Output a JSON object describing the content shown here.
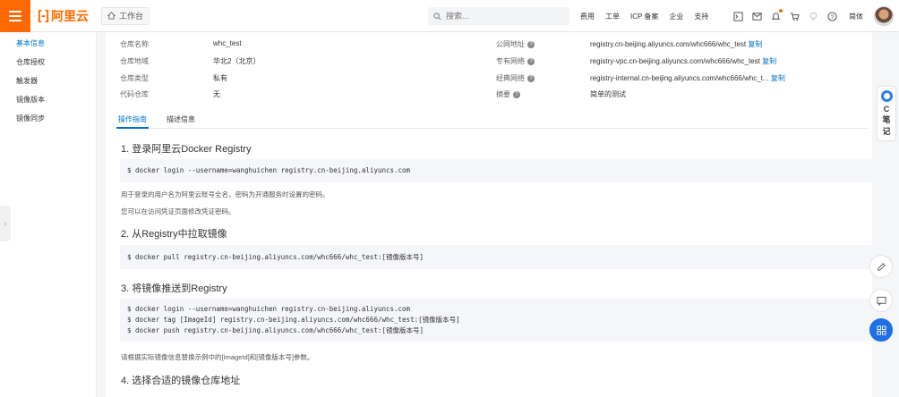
{
  "topbar": {
    "brand": "阿里云",
    "workbench": "工作台",
    "search_placeholder": "搜索...",
    "links": [
      "费用",
      "工单",
      "ICP 备案",
      "企业",
      "支持"
    ],
    "lang": "简体"
  },
  "sidebar": {
    "items": [
      "基本信息",
      "仓库授权",
      "触发器",
      "镜像版本",
      "镜像同步"
    ],
    "active_index": 0
  },
  "repo_info": {
    "name_label": "仓库名称",
    "name_value": "whc_test",
    "region_label": "仓库地域",
    "region_value": "华北2（北京）",
    "type_label": "仓库类型",
    "type_value": "私有",
    "code_label": "代码仓库",
    "code_value": "无",
    "public_label": "公网地址",
    "public_value": "registry.cn-beijing.aliyuncs.com/whc666/whc_test",
    "vpc_label": "专有网络",
    "vpc_value": "registry-vpc.cn-beijing.aliyuncs.com/whc666/whc_test",
    "classic_label": "经典网络",
    "classic_value": "registry-internal.cn-beijing.aliyuncs.com/whc666/whc_t...",
    "summary_label": "摘要",
    "summary_value": "简单的测试",
    "copy_label": "复制"
  },
  "tabs": [
    "操作指南",
    "描述信息"
  ],
  "active_tab": 0,
  "guide": {
    "s1_title": "1. 登录阿里云Docker Registry",
    "s1_cmd": "$ docker login --username=wanghuichen registry.cn-beijing.aliyuncs.com",
    "s1_p1": "用于登录的用户名为阿里云账号全名，密码为开通服务时设置的密码。",
    "s1_p2": "您可以在访问凭证页面修改凭证密码。",
    "s2_title": "2. 从Registry中拉取镜像",
    "s2_cmd": "$ docker pull registry.cn-beijing.aliyuncs.com/whc666/whc_test:[镜像版本号]",
    "s3_title": "3. 将镜像推送到Registry",
    "s3_cmd1": "$ docker login --username=wanghuichen registry.cn-beijing.aliyuncs.com",
    "s3_cmd2": "$ docker tag [ImageId] registry.cn-beijing.aliyuncs.com/whc666/whc_test:[镜像版本号]",
    "s3_cmd3": "$ docker push registry.cn-beijing.aliyuncs.com/whc666/whc_test:[镜像版本号]",
    "s3_p1": "请根据实际镜像信息替换示例中的[ImageId]和[镜像版本号]参数。",
    "s4_title": "4. 选择合适的镜像仓库地址"
  },
  "note_widget": {
    "line1": "C",
    "line2": "笔",
    "line3": "记"
  },
  "colors": {
    "brand": "#ff6a00",
    "link": "#0070cc",
    "fab": "#1f6fe5"
  }
}
